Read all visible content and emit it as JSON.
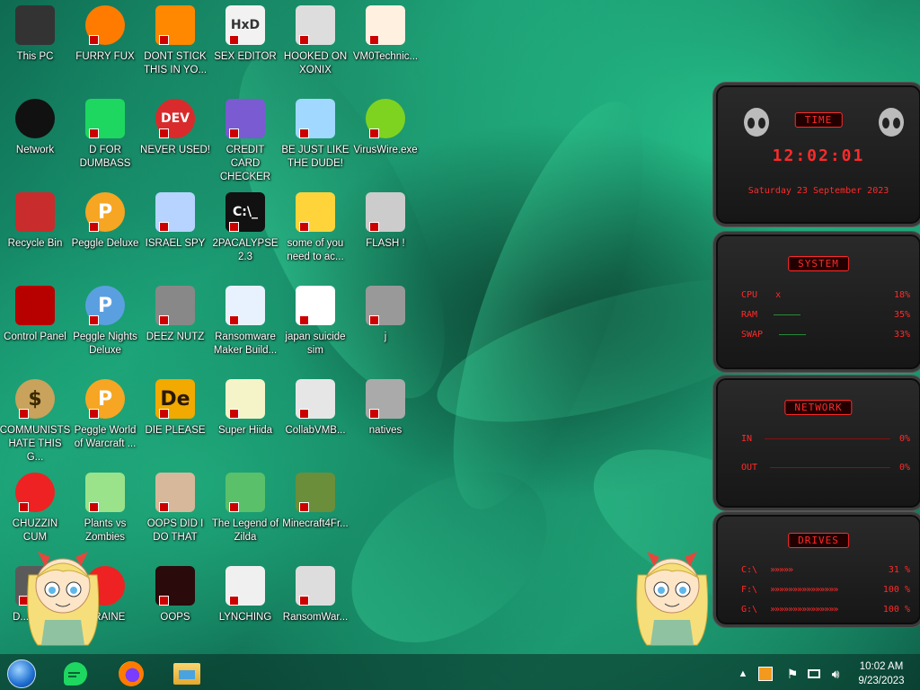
{
  "desktop": {
    "icons": [
      {
        "label": "This PC",
        "glyph": "monitor-icon"
      },
      {
        "label": "FURRY FUX",
        "glyph": "firefox-icon"
      },
      {
        "label": "DONT STICK THIS IN YO...",
        "glyph": "vlc-cone-icon"
      },
      {
        "label": "SEX EDITOR",
        "glyph": "hxd-icon",
        "text": "HxD"
      },
      {
        "label": "HOOKED ON XONIX",
        "glyph": "xonix-icon"
      },
      {
        "label": "VM0Technic...",
        "glyph": "doctor-icon"
      },
      {
        "label": "Network",
        "glyph": "alien-icon"
      },
      {
        "label": "D FOR DUMBASS",
        "glyph": "chat-icon"
      },
      {
        "label": "NEVER USED!",
        "glyph": "devcpp-icon",
        "text": "DEV"
      },
      {
        "label": "CREDIT CARD CHECKER",
        "glyph": "credit-card-icon"
      },
      {
        "label": "BE JUST LIKE THE DUDE!",
        "glyph": "santa-icon"
      },
      {
        "label": "VirusWire.exe",
        "glyph": "lime-icon"
      },
      {
        "label": "Recycle Bin",
        "glyph": "recycle-bin-icon"
      },
      {
        "label": "Peggle Deluxe",
        "glyph": "peggle-icon",
        "text": "P"
      },
      {
        "label": "ISRAEL SPY",
        "glyph": "network-spy-icon"
      },
      {
        "label": "2PACALYPSE 2.3",
        "glyph": "terminal-icon",
        "text": "C:\\_"
      },
      {
        "label": "some of you need to ac...",
        "glyph": "dog-icon"
      },
      {
        "label": "FLASH !",
        "glyph": "flash-icon"
      },
      {
        "label": "Control Panel",
        "glyph": "control-panel-icon"
      },
      {
        "label": "Peggle Nights Deluxe",
        "glyph": "peggle-nights-icon",
        "text": "P"
      },
      {
        "label": "DEEZ NUTZ",
        "glyph": "stack-icon"
      },
      {
        "label": "Ransomware Maker Build...",
        "glyph": "window-icon"
      },
      {
        "label": "japan suicide sim",
        "glyph": "blocks-icon"
      },
      {
        "label": "j",
        "glyph": "j-icon"
      },
      {
        "label": "COMMUNISTS HATE THIS G...",
        "glyph": "money-bag-icon",
        "text": "$"
      },
      {
        "label": "Peggle World of Warcraft ...",
        "glyph": "peggle-wow-icon",
        "text": "P"
      },
      {
        "label": "DIE PLEASE",
        "glyph": "de-icon",
        "text": "De"
      },
      {
        "label": "Super Hiida",
        "glyph": "pixel-icon"
      },
      {
        "label": "CollabVMB...",
        "glyph": "collab-icon"
      },
      {
        "label": "natives",
        "glyph": "natives-icon"
      },
      {
        "label": "CHUZZIN CUM",
        "glyph": "chuzzle-icon"
      },
      {
        "label": "Plants vs Zombies",
        "glyph": "plant-icon"
      },
      {
        "label": "OOPS DID I DO THAT",
        "glyph": "portrait-icon"
      },
      {
        "label": "The Legend of Zilda",
        "glyph": "zelda-icon"
      },
      {
        "label": "Minecraft4Fr...",
        "glyph": "minecraft-icon"
      },
      {
        "label": "",
        "glyph": "blank"
      },
      {
        "label": "D...Bluc...",
        "glyph": "partial-icon"
      },
      {
        "label": "...RAINE",
        "glyph": "radiation-icon"
      },
      {
        "label": "OOPS",
        "glyph": "oops-icon"
      },
      {
        "label": "LYNCHING",
        "glyph": "lynch-icon"
      },
      {
        "label": "RansomWar...",
        "glyph": "skull-icon"
      }
    ]
  },
  "widgets": {
    "time": {
      "title": "TIME",
      "clock": "12:02:01",
      "date": "Saturday 23 September 2023"
    },
    "system": {
      "title": "SYSTEM",
      "rows": [
        {
          "label": "CPU",
          "value": "18%"
        },
        {
          "label": "RAM",
          "value": "35%"
        },
        {
          "label": "SWAP",
          "value": "33%"
        }
      ]
    },
    "network": {
      "title": "NETWORK",
      "rows": [
        {
          "label": "IN",
          "value": "0%"
        },
        {
          "label": "OUT",
          "value": "0%"
        }
      ]
    },
    "drives": {
      "title": "DRIVES",
      "rows": [
        {
          "label": "C:\\",
          "value": "31 %"
        },
        {
          "label": "F:\\",
          "value": "100 %"
        },
        {
          "label": "G:\\",
          "value": "100 %"
        }
      ]
    }
  },
  "taskbar": {
    "time": "10:02 AM",
    "date": "9/23/2023",
    "pinned": [
      "start-orb-icon",
      "chat-icon",
      "firefox-icon",
      "file-explorer-icon"
    ],
    "tray": [
      "chevron-up-icon",
      "app-tray-icon",
      "flag-icon",
      "network-icon",
      "volume-icon"
    ]
  }
}
